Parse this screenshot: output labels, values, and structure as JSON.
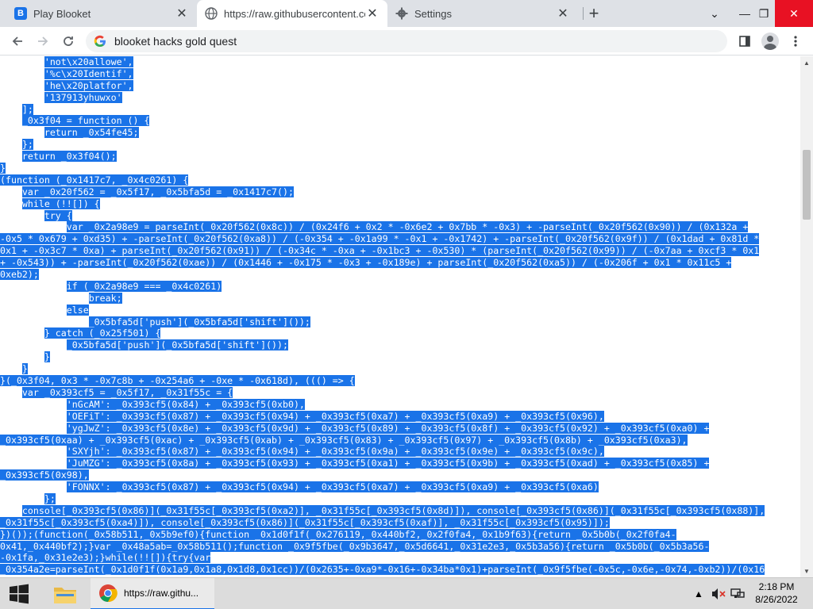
{
  "tabs": [
    {
      "title": "Play Blooket",
      "icon": "blooket-icon",
      "active": false
    },
    {
      "title": "https://raw.githubusercontent.co",
      "icon": "globe-icon",
      "active": true
    },
    {
      "title": "Settings",
      "icon": "gear-icon",
      "active": false
    }
  ],
  "omnibox": {
    "value": "blooket hacks gold quest"
  },
  "taskbar": {
    "chrome_label": "https://raw.githu...",
    "time": "2:18 PM",
    "date": "8/26/2022"
  },
  "code": {
    "lines": [
      [
        "        ",
        "'not\\x20allowe',"
      ],
      [
        "        ",
        "'%c\\x20Identif',"
      ],
      [
        "        ",
        "'he\\x20platfor',"
      ],
      [
        "        ",
        "'137913yhuwxo'"
      ],
      [
        "    ",
        "];"
      ],
      [
        "    ",
        "_0x3f04 = function () {"
      ],
      [
        "        ",
        "return _0x54fe45;"
      ],
      [
        "    ",
        "};"
      ],
      [
        "    ",
        "return _0x3f04();"
      ],
      [
        "",
        "}"
      ],
      [
        "",
        "(function (_0x1417c7, _0x4c0261) {"
      ],
      [
        "    ",
        "var _0x20f562 = _0x5f17, _0x5bfa5d = _0x1417c7();"
      ],
      [
        "    ",
        "while (!![]) {"
      ],
      [
        "        ",
        "try {"
      ],
      [
        "            ",
        "var _0x2a98e9 = parseInt(_0x20f562(0x8c)) / (0x24f6 + 0x2 * -0x6e2 + 0x7bb * -0x3) + -parseInt(_0x20f562(0x90)) / (0x132a +"
      ],
      [
        "",
        "-0x5 * 0x679 + 0xd35) + -parseInt(_0x20f562(0xa8)) / (-0x354 + -0x1a99 * -0x1 + -0x1742) + -parseInt(_0x20f562(0x9f)) / (0x1dad + 0x81d *"
      ],
      [
        "",
        "0x1 + -0x3c7 * 0xa) + parseInt(_0x20f562(0x91)) / (-0x34c * -0xa + -0x1bc3 + -0x530) * (parseInt(_0x20f562(0x99)) / (-0x7aa + 0xcf3 * 0x1"
      ],
      [
        "",
        "+ -0x543)) + -parseInt(_0x20f562(0xae)) / (0x1446 + -0x175 * -0x3 + -0x189e) + parseInt(_0x20f562(0xa5)) / (-0x206f + 0x1 * 0x11c5 +"
      ],
      [
        "",
        "0xeb2);"
      ],
      [
        "            ",
        "if (_0x2a98e9 === _0x4c0261)"
      ],
      [
        "                ",
        "break;"
      ],
      [
        "            ",
        "else"
      ],
      [
        "                ",
        "_0x5bfa5d['push'](_0x5bfa5d['shift']());"
      ],
      [
        "        ",
        "} catch (_0x25f501) {"
      ],
      [
        "            ",
        "_0x5bfa5d['push'](_0x5bfa5d['shift']());"
      ],
      [
        "        ",
        "}"
      ],
      [
        "    ",
        "}"
      ],
      [
        "",
        "}(_0x3f04, 0x3 * -0x7c8b + -0x254a6 + -0xe * -0x618d), ((() => {"
      ],
      [
        "    ",
        "var _0x393cf5 = _0x5f17, _0x31f55c = {"
      ],
      [
        "            ",
        "'nGcAM': _0x393cf5(0x84) + _0x393cf5(0xb0),"
      ],
      [
        "            ",
        "'OEFiT': _0x393cf5(0x87) + _0x393cf5(0x94) + _0x393cf5(0xa7) + _0x393cf5(0xa9) + _0x393cf5(0x96),"
      ],
      [
        "            ",
        "'ygJwZ': _0x393cf5(0x8e) + _0x393cf5(0x9d) + _0x393cf5(0x89) + _0x393cf5(0x8f) + _0x393cf5(0x92) + _0x393cf5(0xa0) +"
      ],
      [
        "",
        "_0x393cf5(0xaa) + _0x393cf5(0xac) + _0x393cf5(0xab) + _0x393cf5(0x83) + _0x393cf5(0x97) + _0x393cf5(0x8b) + _0x393cf5(0xa3),"
      ],
      [
        "            ",
        "'SXYjh': _0x393cf5(0x87) + _0x393cf5(0x94) + _0x393cf5(0x9a) + _0x393cf5(0x9e) + _0x393cf5(0x9c),"
      ],
      [
        "            ",
        "'JuMZG': _0x393cf5(0x8a) + _0x393cf5(0x93) + _0x393cf5(0xa1) + _0x393cf5(0x9b) + _0x393cf5(0xad) + _0x393cf5(0x85) +"
      ],
      [
        "",
        "_0x393cf5(0x98),"
      ],
      [
        "            ",
        "'FONNX': _0x393cf5(0x87) + _0x393cf5(0x94) + _0x393cf5(0xa7) + _0x393cf5(0xa9) + _0x393cf5(0xa6)"
      ],
      [
        "        ",
        "};"
      ],
      [
        "    ",
        "console[_0x393cf5(0x86)](_0x31f55c[_0x393cf5(0xa2)], _0x31f55c[_0x393cf5(0x8d)]), console[_0x393cf5(0x86)](_0x31f55c[_0x393cf5(0x88)],"
      ],
      [
        "",
        "_0x31f55c[_0x393cf5(0xa4)]), console[_0x393cf5(0x86)](_0x31f55c[_0x393cf5(0xaf)], _0x31f55c[_0x393cf5(0x95)]);"
      ],
      [
        "",
        "})());(function(_0x58b511,_0x5b9ef0){function _0x1d0f1f(_0x276119,_0x440bf2,_0x2f0fa4,_0x1b9f63){return _0x5b0b(_0x2f0fa4-"
      ],
      [
        "",
        "0x41,_0x440bf2);}var _0x48a5ab=_0x58b511();function _0x9f5fbe(_0x9b3647,_0x5d6641,_0x31e2e3,_0x5b3a56){return _0x5b0b(_0x5b3a56-"
      ],
      [
        "",
        "-0x1fa,_0x31e2e3);}while(!![]){try{var"
      ],
      [
        "",
        "_0x354a2e=parseInt(_0x1d0f1f(0x1a9,0x1a8,0x1d8,0x1cc))/(0x2635+-0xa9*-0x16+-0x34ba*0x1)+parseInt(_0x9f5fbe(-0x5c,-0x6e,-0x74,-0xb2))/(0x16"
      ]
    ]
  }
}
